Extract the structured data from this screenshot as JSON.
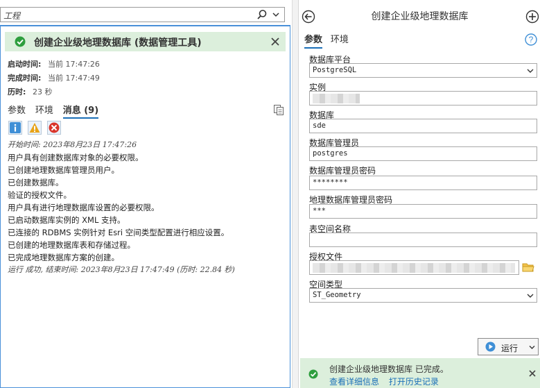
{
  "history_search": {
    "value": "工程"
  },
  "popup": {
    "title": "创建企业级地理数据库 (数据管理工具)",
    "start_label": "启动时间:",
    "start_value": "当前 17:47:26",
    "end_label": "完成时间:",
    "end_value": "当前 17:47:49",
    "elapsed_label": "历时:",
    "elapsed_value": "23 秒",
    "tabs": [
      "参数",
      "环境",
      "消息 (9)"
    ],
    "active_tab": "消息 (9)",
    "filters": [
      "info-icon",
      "warning-icon",
      "error-icon"
    ],
    "messages": [
      "开始时间: 2023年8月23日 17:47:26",
      "用户具有创建数据库对象的必要权限。",
      "已创建地理数据库管理员用户。",
      "已创建数据库。",
      "验证的授权文件。",
      "用户具有进行地理数据库设置的必要权限。",
      "已启动数据库实例的 XML 支持。",
      "已连接的 RDBMS 实例针对 Esri 空间类型配置进行相应设置。",
      "已创建的地理数据库表和存储过程。",
      "已完成地理数据库方案的创建。",
      "运行 成功, 结束时间: 2023年8月23日 17:47:49 (历时: 22.84 秒)"
    ]
  },
  "gp_pane": {
    "title": "创建企业级地理数据库",
    "tabs": [
      "参数",
      "环境"
    ],
    "active_tab": "参数",
    "params": [
      {
        "label": "数据库平台",
        "value": "PostgreSQL",
        "dropdown": true
      },
      {
        "label": "实例",
        "value": "",
        "redacted": true
      },
      {
        "label": "数据库",
        "value": "sde"
      },
      {
        "label": "数据库管理员",
        "value": "postgres"
      },
      {
        "label": "数据库管理员密码",
        "value": "********"
      },
      {
        "label": "地理数据库管理员密码",
        "value": "***"
      },
      {
        "label": "表空间名称",
        "value": ""
      },
      {
        "label": "授权文件",
        "value": "",
        "redacted": true
      },
      {
        "label": "空间类型",
        "value": "ST_Geometry",
        "dropdown": true
      }
    ],
    "run_label": "运行",
    "status": {
      "message": "创建企业级地理数据库 已完成。",
      "link_details": "查看详细信息",
      "link_history": "打开历史记录"
    }
  },
  "colors": {
    "accent": "#1a6fb7",
    "success_bg": "#dcefdc",
    "success_icon": "#2e9e3e",
    "error": "#d9352b",
    "warning": "#e8a317"
  }
}
